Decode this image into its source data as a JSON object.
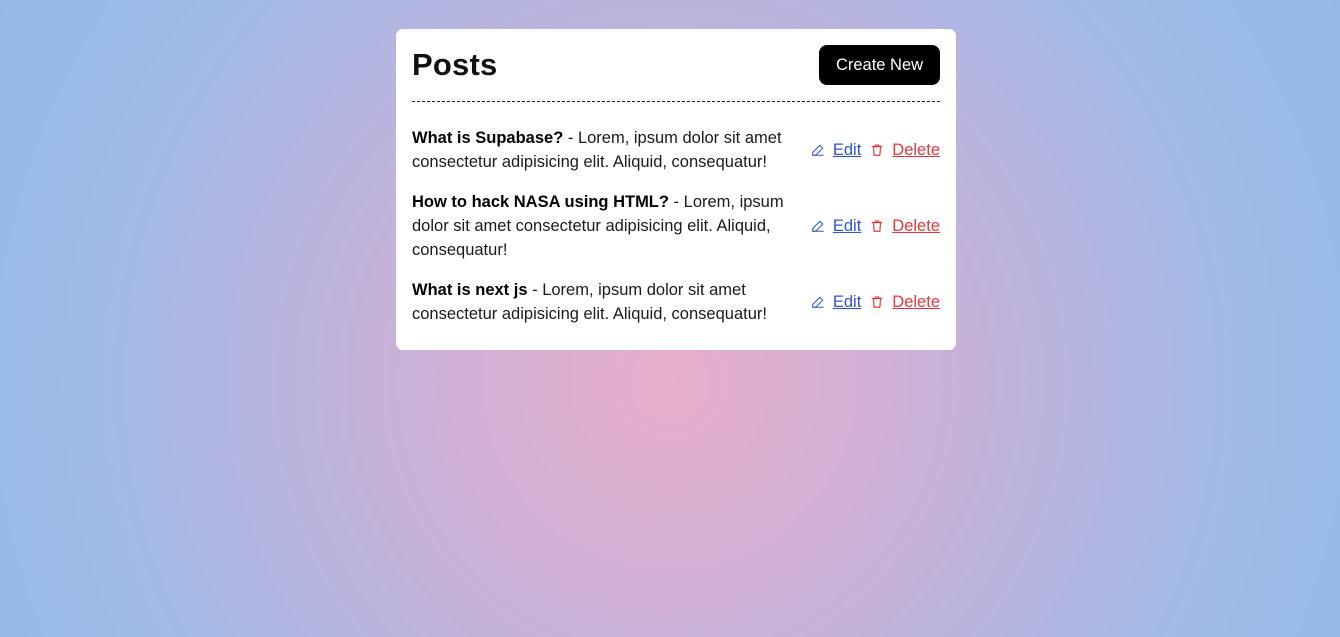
{
  "page": {
    "title": "Posts",
    "create_button": "Create New"
  },
  "posts": [
    {
      "title": "What is Supabase?",
      "separator": " - ",
      "body": "Lorem, ipsum dolor sit amet consectetur adipisicing elit. Aliquid, consequatur!",
      "edit_label": "Edit",
      "delete_label": "Delete"
    },
    {
      "title": "How to hack NASA using HTML?",
      "separator": " - ",
      "body": "Lorem, ipsum dolor sit amet consectetur adipisicing elit. Aliquid, consequatur!",
      "edit_label": "Edit",
      "delete_label": "Delete"
    },
    {
      "title": "What is next js",
      "separator": " - ",
      "body": "Lorem, ipsum dolor sit amet consectetur adipisicing elit. Aliquid, consequatur!",
      "edit_label": "Edit",
      "delete_label": "Delete"
    }
  ],
  "icons": {
    "edit": "pencil-icon",
    "delete": "trash-icon"
  },
  "colors": {
    "edit_link": "#2f55c9",
    "delete_link": "#e0383e",
    "button_bg": "#000000"
  }
}
